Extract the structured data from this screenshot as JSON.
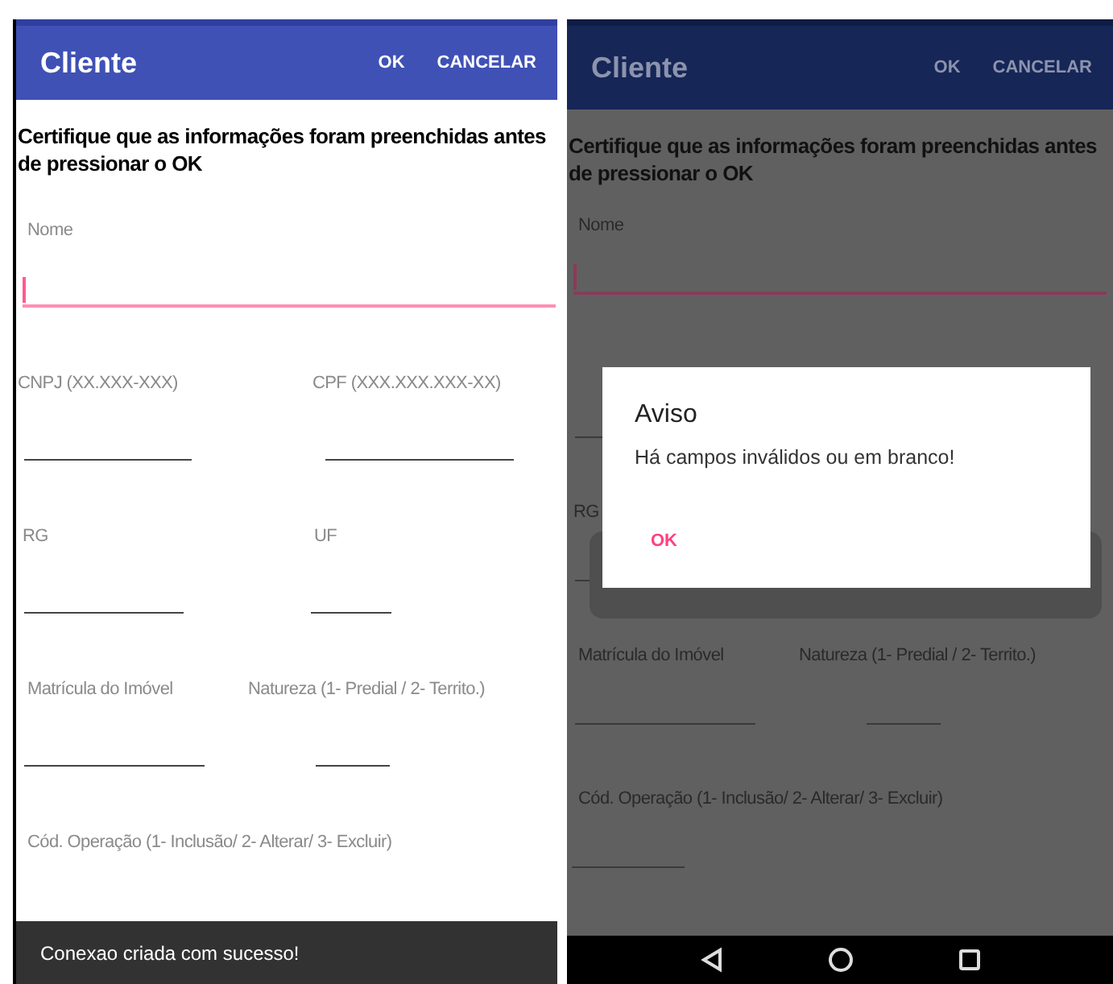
{
  "screens": [
    {
      "dimmed": false,
      "app_bar": {
        "title": "Cliente",
        "actions": [
          "OK",
          "CANCELAR"
        ]
      },
      "notice": "Certifique que as informações foram preenchidas antes de pressionar o OK",
      "rows": [
        [
          {
            "label": "Nome",
            "focused": true
          }
        ],
        [
          {
            "label": "CNPJ (XX.XXX-XXX)",
            "focused": false
          },
          {
            "label": "CPF (XXX.XXX.XXX-XX)",
            "focused": false
          }
        ],
        [
          {
            "label": "RG",
            "focused": false
          },
          {
            "label": "UF",
            "focused": false
          }
        ],
        [
          {
            "label": "Matrícula do Imóvel",
            "focused": false
          },
          {
            "label": "Natureza (1- Predial / 2- Territo.)",
            "focused": false
          }
        ],
        [
          {
            "label": "Cód. Operação (1- Inclusão/ 2- Alterar/ 3- Excluir)"
          }
        ]
      ],
      "snackbar": "Conexao criada com sucesso!"
    },
    {
      "dimmed": true,
      "app_bar": {
        "title": "Cliente",
        "actions": [
          "OK",
          "CANCELAR"
        ]
      },
      "notice": "Certifique que as informações foram preenchidas antes de pressionar o OK",
      "rows": [
        [
          {
            "label": "Nome",
            "focused": true
          }
        ],
        [
          {
            "focused": false
          }
        ],
        [
          {
            "label": "RG",
            "focused": false
          }
        ],
        [
          {
            "label": "Matrícula do Imóvel",
            "focused": false
          },
          {
            "label": "Natureza (1- Predial / 2- Territo.)",
            "focused": false
          }
        ],
        [
          {
            "label": "Cód. Operação (1- Inclusão/ 2- Alterar/ 3- Excluir)",
            "focused": false
          }
        ]
      ],
      "dialog": {
        "title": "Aviso",
        "message": "Há campos inválidos ou em branco!",
        "button": "OK"
      },
      "nav_bar": true
    }
  ]
}
